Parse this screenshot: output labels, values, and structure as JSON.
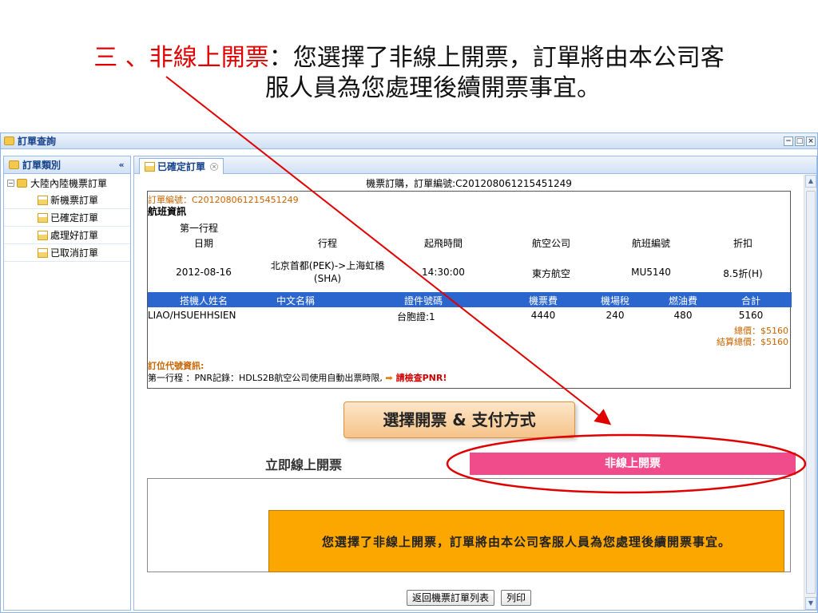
{
  "slide": {
    "heading_prefix": "三 、",
    "heading_highlight": "非線上開票",
    "heading_rest": "：您選擇了非線上開票，訂單將由本公司客",
    "heading_line2": "服人員為您處理後續開票事宜。"
  },
  "window": {
    "title": "訂單查詢",
    "controls": [
      "−",
      "□",
      "×"
    ]
  },
  "sidebar": {
    "title": "訂單類別",
    "collapse": "«",
    "root": "大陸內陸機票訂單",
    "items": [
      "新機票訂單",
      "已確定訂單",
      "處理好訂單",
      "已取消訂單"
    ]
  },
  "tab": {
    "label": "已確定訂單",
    "close": "×"
  },
  "order": {
    "caption": "機票訂購，訂單編號:C201208061215451249",
    "order_no": "訂單編號：C201208061215451249",
    "flight_section": "航班資訊",
    "itinerary_label": "第一行程",
    "columns": [
      "日期",
      "行程",
      "起飛時間",
      "航空公司",
      "航班編號",
      "折扣"
    ],
    "flight": {
      "date": "2012-08-16",
      "route_line1": "北京首都(PEK)->上海虹橋",
      "route_line2": "(SHA)",
      "departure": "14:30:00",
      "airline": "東方航空",
      "flight_no": "MU5140",
      "discount": "8.5折(H)"
    },
    "pax_columns": [
      "搭機人姓名",
      "中文名稱",
      "證件號碼",
      "機票費",
      "機場稅",
      "燃油費",
      "合計"
    ],
    "passenger": {
      "name": "LIAO/HSUEHHSIEN",
      "chinese_name": "",
      "id": "台胞證:1",
      "fare": "4440",
      "airport_tax": "240",
      "fuel": "480",
      "total": "5160"
    },
    "total_price": "總價：$5160",
    "settle_total": "結算總價：$5160",
    "pnr_title": "訂位代號資訊:",
    "pnr_text": "第一行程 ：PNR記錄：HDLS2B航空公司使用自動出票時限,",
    "pnr_arrow": "➡",
    "pnr_check": "請檢查PNR!"
  },
  "payment": {
    "button": "選擇開票 & 支付方式",
    "option_online": "立即線上開票",
    "option_offline": "非線上開票",
    "message": "您選擇了非線上開票，訂單將由本公司客服人員為您處理後續開票事宜。"
  },
  "buttons": {
    "back": "返回機票訂單列表",
    "print": "列印"
  },
  "colors": {
    "highlight_red": "#e00000",
    "header_blue": "#2b66cf",
    "offline_pink": "#f04c8c",
    "message_orange": "#fca600"
  }
}
